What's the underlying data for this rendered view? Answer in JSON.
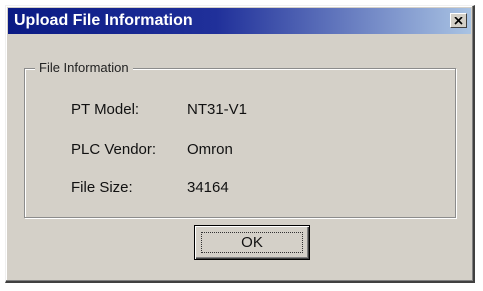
{
  "dialog": {
    "title": "Upload File Information",
    "close_icon": "close-icon",
    "group_label": "File Information",
    "rows": [
      {
        "label": "PT Model:",
        "value": "NT31-V1"
      },
      {
        "label": "PLC Vendor:",
        "value": "Omron"
      },
      {
        "label": "File Size:",
        "value": "34164"
      }
    ],
    "ok_label": "OK"
  },
  "colors": {
    "title_start": "#0a1a84",
    "title_end": "#a9c3e3",
    "face": "#d4d0c8"
  }
}
